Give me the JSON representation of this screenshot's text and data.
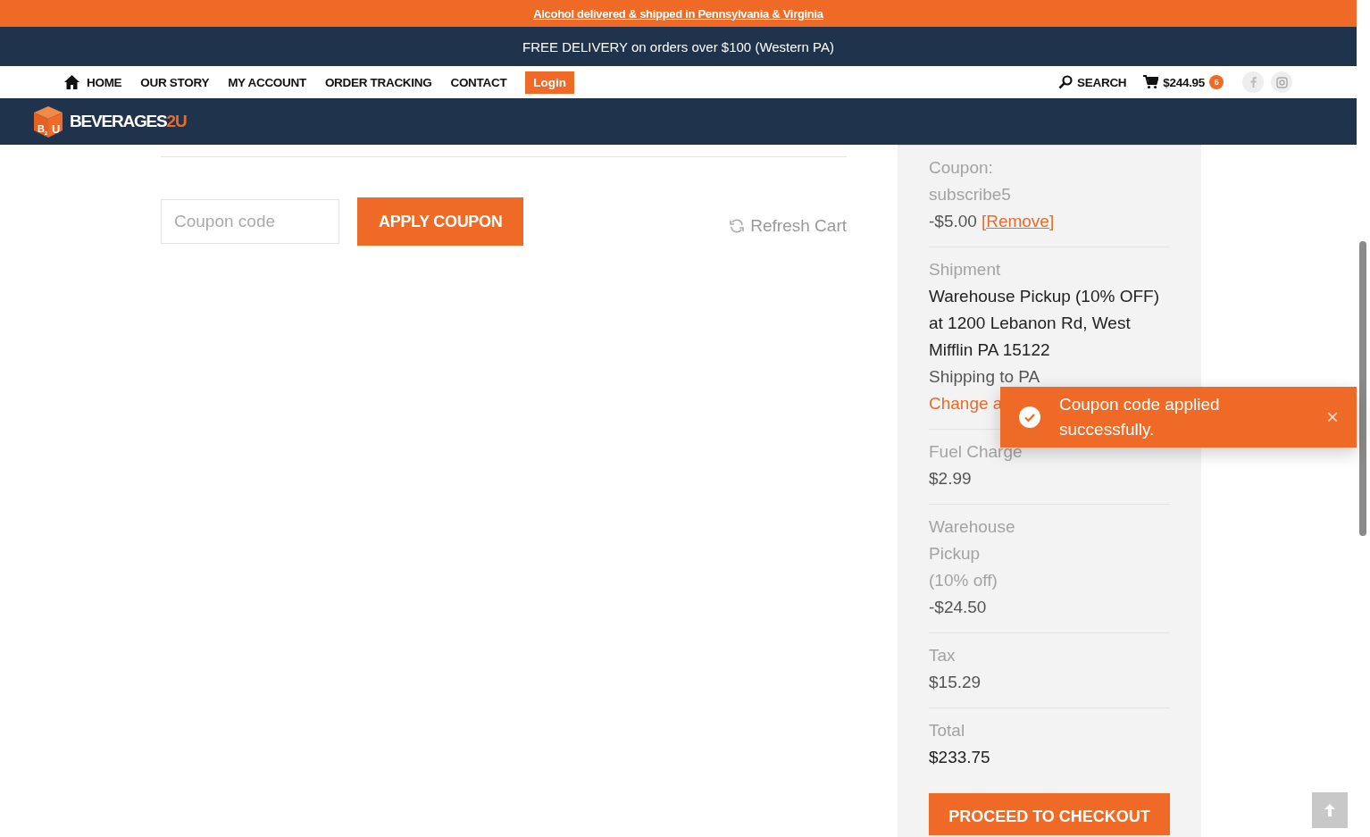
{
  "promo_bar": {
    "text": "Alcohol delivered & shipped in Pennsylvania & Virginia"
  },
  "delivery_bar": {
    "text": "FREE DELIVERY on orders over $100 (Western PA)"
  },
  "nav": {
    "items": [
      {
        "label": "HOME",
        "kind": "home"
      },
      {
        "label": "OUR STORY",
        "kind": "link"
      },
      {
        "label": "MY ACCOUNT",
        "kind": "link"
      },
      {
        "label": "ORDER TRACKING",
        "kind": "link"
      },
      {
        "label": "CONTACT",
        "kind": "link"
      },
      {
        "label": "Login",
        "kind": "button"
      }
    ],
    "search": "SEARCH",
    "cart_total": "$244.95",
    "cart_count": "5"
  },
  "logo": {
    "mark_left": "B",
    "mark_sub": "2",
    "mark_right": "U",
    "name": "BEVERAGES",
    "name_accent": "2U"
  },
  "coupon": {
    "placeholder": "Coupon code",
    "apply": "APPLY COUPON",
    "refresh": "Refresh Cart"
  },
  "summary": {
    "rows": [
      {
        "lines": [
          {
            "kind": "label",
            "text": "Coupon:"
          },
          {
            "kind": "label",
            "text": "subscribe5"
          },
          {
            "kind": "amount",
            "text": "-$5.00",
            "link": "[Remove]"
          }
        ]
      },
      {
        "lines": [
          {
            "kind": "label",
            "text": "Shipment"
          },
          {
            "kind": "value",
            "text": "Warehouse Pickup (10% OFF)"
          },
          {
            "kind": "value",
            "text": "at 1200 Lebanon Rd, West"
          },
          {
            "kind": "value",
            "text": "Mifflin PA 15122"
          },
          {
            "kind": "amount",
            "text": "Shipping to PA"
          },
          {
            "kind": "link",
            "text": "Change a"
          }
        ]
      },
      {
        "lines": [
          {
            "kind": "label",
            "text": "Fuel Charge"
          },
          {
            "kind": "amount",
            "text": "$2.99"
          }
        ]
      },
      {
        "lines": [
          {
            "kind": "label",
            "text": "Warehouse"
          },
          {
            "kind": "label",
            "text": "Pickup"
          },
          {
            "kind": "label",
            "text": "(10% off)"
          },
          {
            "kind": "amount",
            "text": "-$24.50"
          }
        ]
      },
      {
        "lines": [
          {
            "kind": "label",
            "text": "Tax"
          },
          {
            "kind": "amount",
            "text": "$15.29"
          }
        ]
      },
      {
        "lines": [
          {
            "kind": "label",
            "text": "Total"
          },
          {
            "kind": "value",
            "text": "$233.75"
          }
        ]
      }
    ],
    "checkout": "PROCEED TO CHECKOUT"
  },
  "toast": {
    "message": "Coupon code applied successfully.",
    "close": "×"
  }
}
